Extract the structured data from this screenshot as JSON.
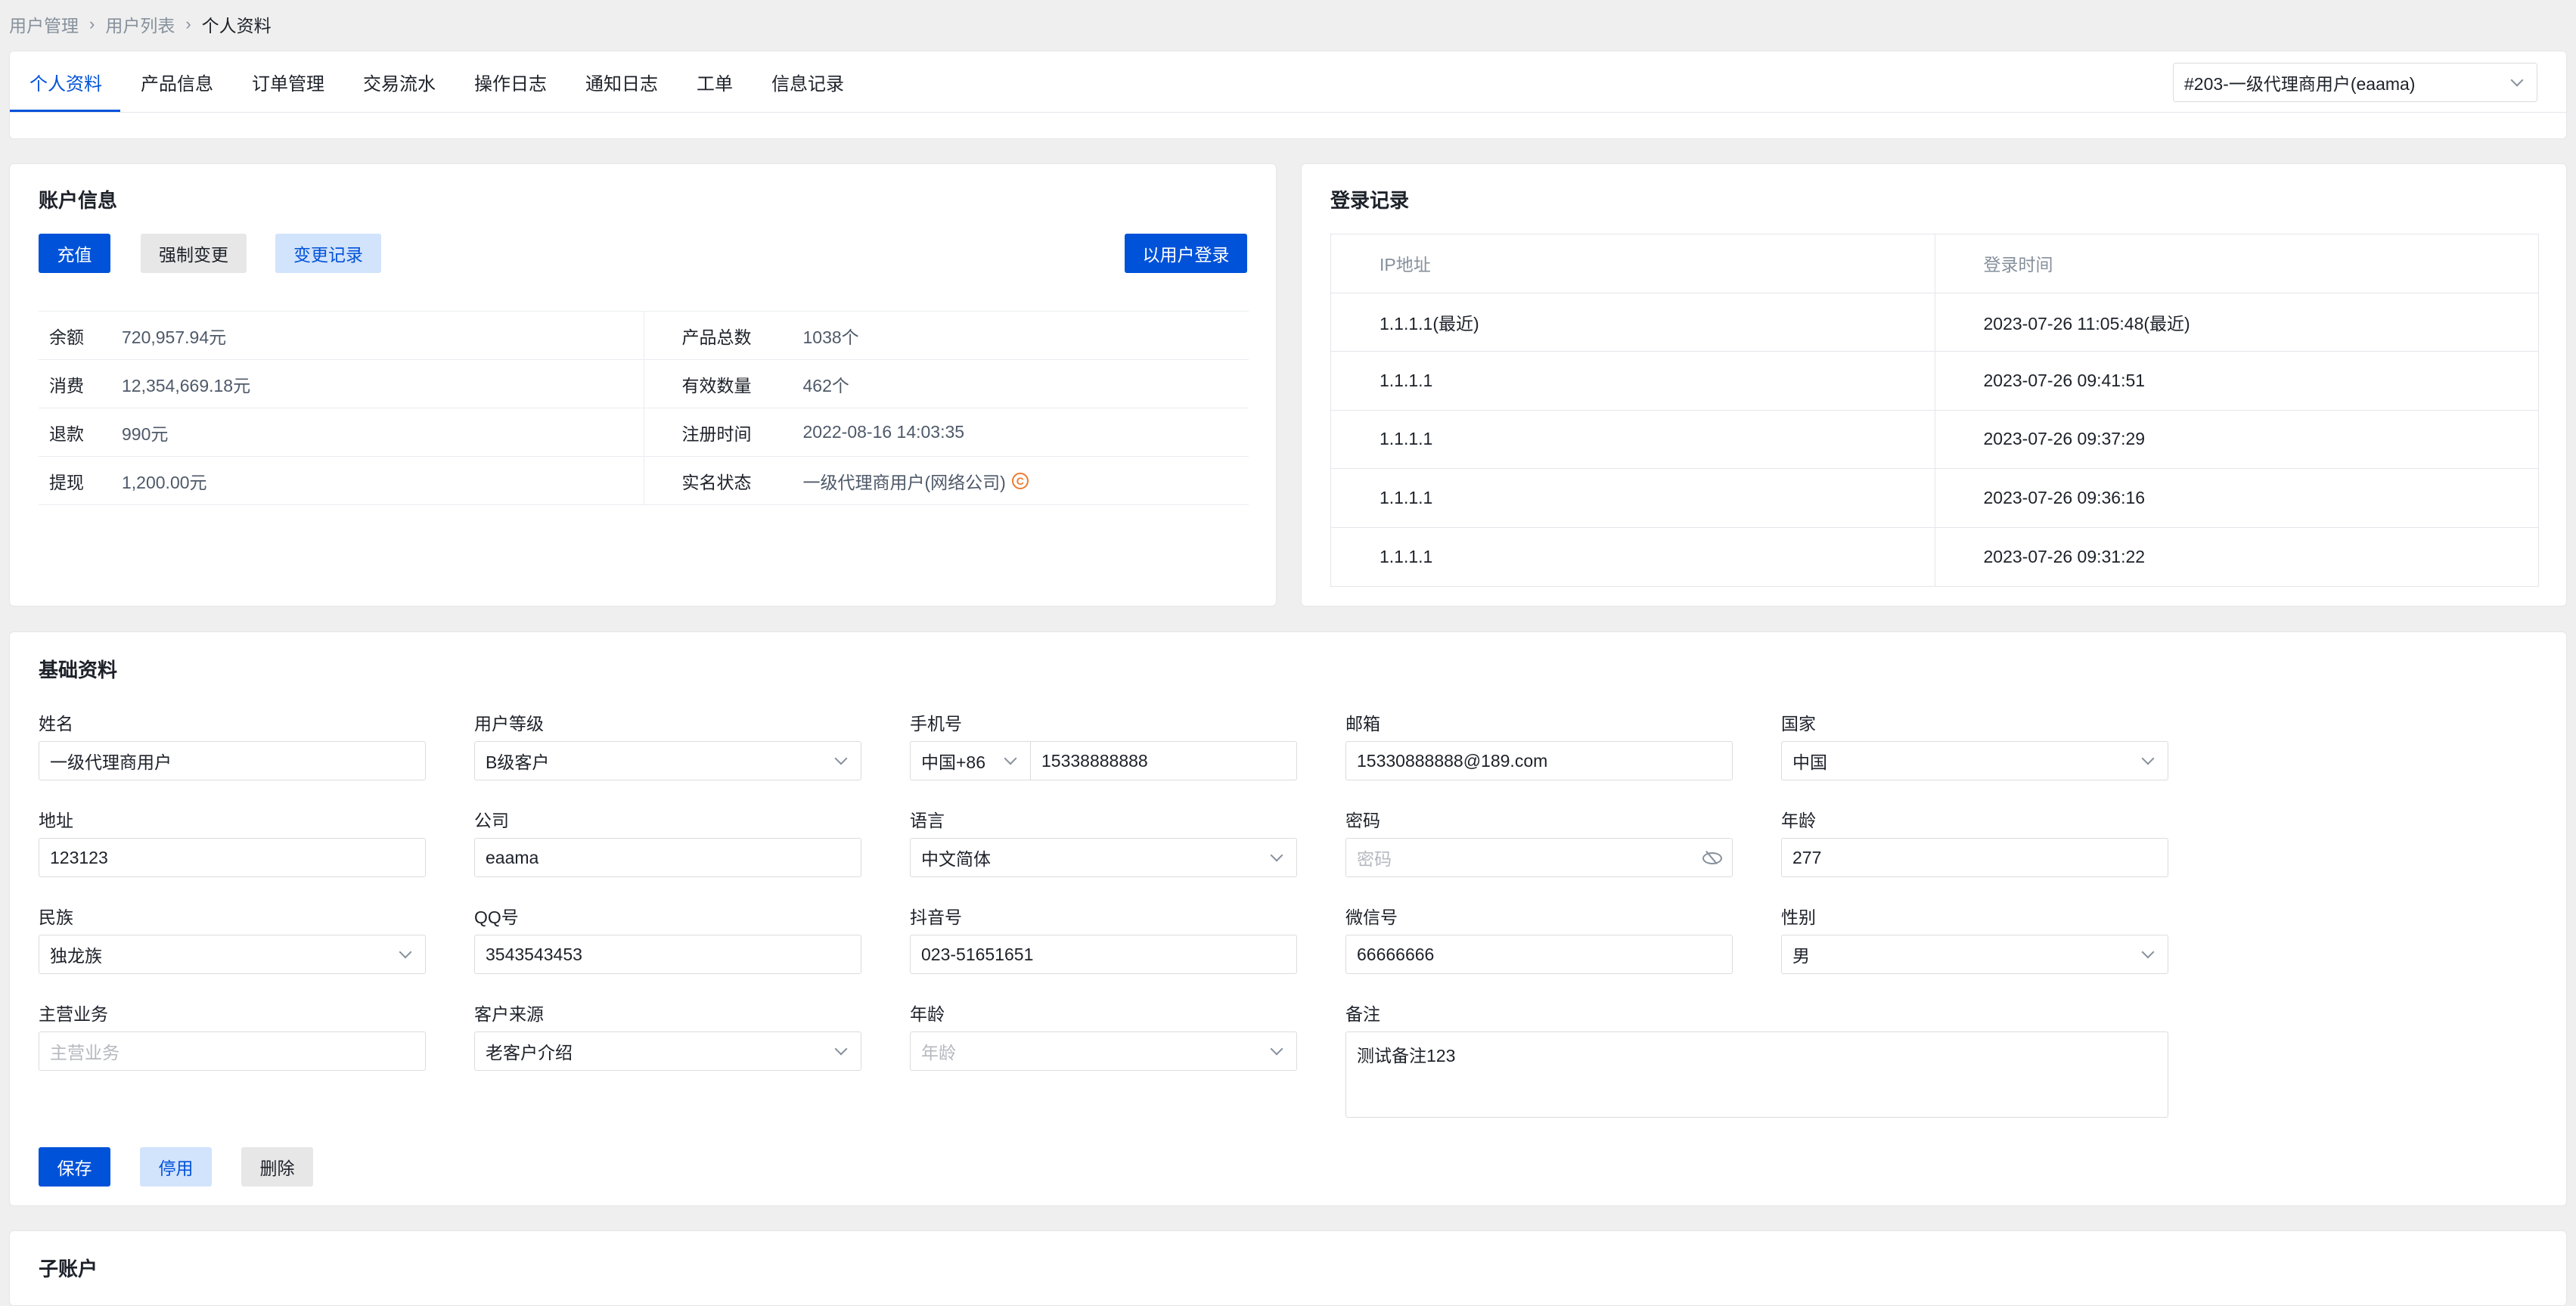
{
  "breadcrumb": [
    "用户管理",
    "用户列表",
    "个人资料"
  ],
  "tabs": [
    {
      "label": "个人资料",
      "active": true
    },
    {
      "label": "产品信息"
    },
    {
      "label": "订单管理"
    },
    {
      "label": "交易流水"
    },
    {
      "label": "操作日志"
    },
    {
      "label": "通知日志"
    },
    {
      "label": "工单"
    },
    {
      "label": "信息记录"
    }
  ],
  "user_select": {
    "value": "#203-一级代理商用户(eaama)"
  },
  "account": {
    "title": "账户信息",
    "buttons": {
      "recharge": "充值",
      "force_change": "强制变更",
      "change_log": "变更记录",
      "login_as_user": "以用户登录"
    },
    "rows": [
      {
        "l_label": "余额",
        "l_value": "720,957.94元",
        "r_label": "产品总数",
        "r_value": "1038个"
      },
      {
        "l_label": "消费",
        "l_value": "12,354,669.18元",
        "r_label": "有效数量",
        "r_value": "462个"
      },
      {
        "l_label": "退款",
        "l_value": "990元",
        "r_label": "注册时间",
        "r_value": "2022-08-16 14:03:35"
      },
      {
        "l_label": "提现",
        "l_value": "1,200.00元",
        "r_label": "实名状态",
        "r_value": "一级代理商用户(网络公司)"
      }
    ]
  },
  "login": {
    "title": "登录记录",
    "headers": [
      "IP地址",
      "登录时间"
    ],
    "rows": [
      [
        "1.1.1.1(最近)",
        "2023-07-26 11:05:48(最近)"
      ],
      [
        "1.1.1.1",
        "2023-07-26 09:41:51"
      ],
      [
        "1.1.1.1",
        "2023-07-26 09:37:29"
      ],
      [
        "1.1.1.1",
        "2023-07-26 09:36:16"
      ],
      [
        "1.1.1.1",
        "2023-07-26 09:31:22"
      ]
    ]
  },
  "basic": {
    "title": "基础资料",
    "name": {
      "label": "姓名",
      "value": "一级代理商用户"
    },
    "level": {
      "label": "用户等级",
      "value": "B级客户"
    },
    "phone": {
      "label": "手机号",
      "code": "中国+86",
      "value": "15338888888"
    },
    "email": {
      "label": "邮箱",
      "value": "15330888888@189.com"
    },
    "country": {
      "label": "国家",
      "value": "中国"
    },
    "address": {
      "label": "地址",
      "value": "123123"
    },
    "company": {
      "label": "公司",
      "value": "eaama"
    },
    "language": {
      "label": "语言",
      "value": "中文简体"
    },
    "password": {
      "label": "密码",
      "placeholder": "密码"
    },
    "age": {
      "label": "年龄",
      "value": "277"
    },
    "ethnicity": {
      "label": "民族",
      "value": "独龙族"
    },
    "qq": {
      "label": "QQ号",
      "value": "3543543453"
    },
    "douyin": {
      "label": "抖音号",
      "value": "023-51651651"
    },
    "wechat": {
      "label": "微信号",
      "value": "66666666"
    },
    "gender": {
      "label": "性别",
      "value": "男"
    },
    "business": {
      "label": "主营业务",
      "placeholder": "主营业务"
    },
    "source": {
      "label": "客户来源",
      "value": "老客户介绍"
    },
    "age2": {
      "label": "年龄",
      "placeholder": "年龄"
    },
    "remark": {
      "label": "备注",
      "value": "测试备注123"
    },
    "buttons": {
      "save": "保存",
      "disable": "停用",
      "delete": "删除"
    }
  },
  "sub_account": {
    "title": "子账户"
  },
  "colors": {
    "primary": "#0052d9",
    "light_primary": "#d2e3fc",
    "page_bg": "#efefef"
  }
}
